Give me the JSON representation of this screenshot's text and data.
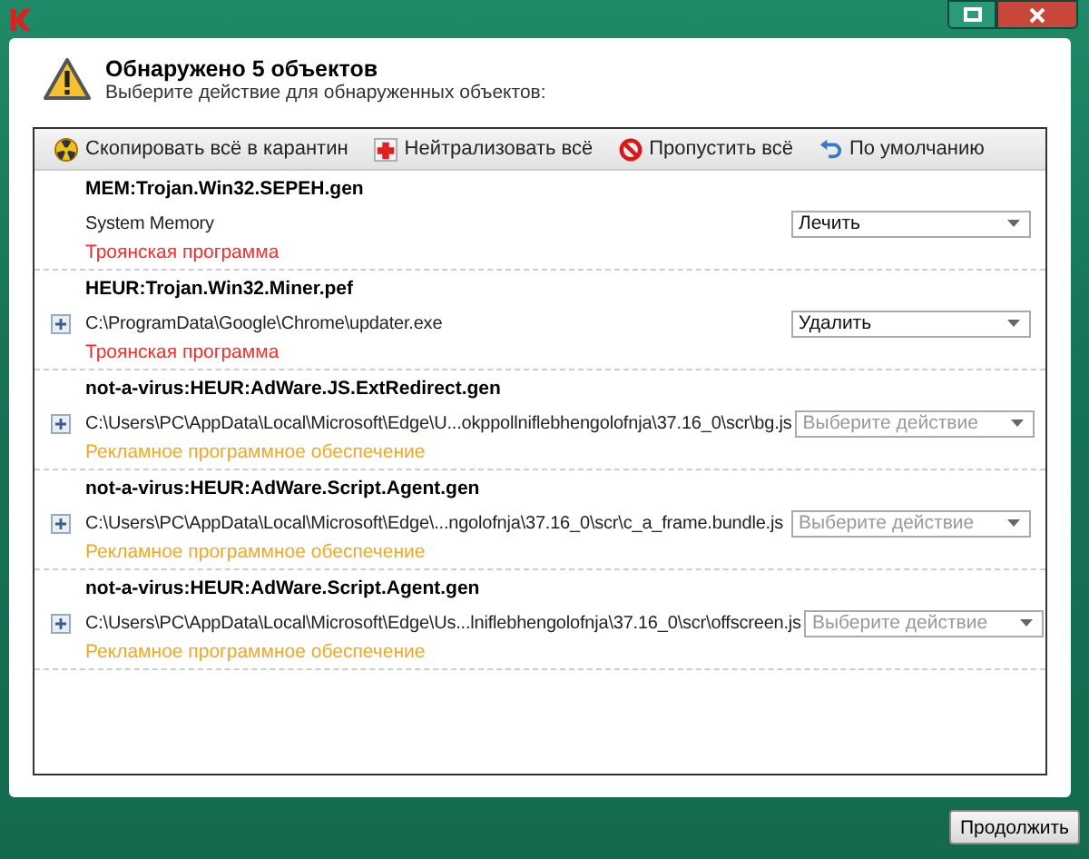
{
  "header": {
    "title": "Обнаружено 5 объектов",
    "subtitle": "Выберите действие для обнаруженных объектов:"
  },
  "toolbar": [
    {
      "label": "Скопировать всё в карантин",
      "kind": "quarantine"
    },
    {
      "label": "Нейтрализовать всё",
      "kind": "cure"
    },
    {
      "label": "Пропустить всё",
      "kind": "skip"
    },
    {
      "label": "По умолчанию",
      "kind": "default"
    }
  ],
  "threats": [
    {
      "name": "MEM:Trojan.Win32.SEPEH.gen",
      "path": "System Memory",
      "category": "Троянская программа",
      "color": "#ff2a2a",
      "expandable": false,
      "action": {
        "value": "Лечить"
      }
    },
    {
      "name": "HEUR:Trojan.Win32.Miner.pef",
      "path": "C:\\ProgramData\\Google\\Chrome\\updater.exe",
      "category": "Троянская программа",
      "color": "#ff2a2a",
      "expandable": true,
      "action": {
        "value": "Удалить"
      }
    },
    {
      "name": "not-a-virus:HEUR:AdWare.JS.ExtRedirect.gen",
      "path": "C:\\Users\\PC\\AppData\\Local\\Microsoft\\Edge\\U...okppollniflebhengolofnja\\37.16_0\\scr\\bg.js",
      "category": "Рекламное программное обеспечение",
      "color": "#f5a623",
      "expandable": true,
      "action": {
        "placeholder": "Выберите действие"
      }
    },
    {
      "name": "not-a-virus:HEUR:AdWare.Script.Agent.gen",
      "path": "C:\\Users\\PC\\AppData\\Local\\Microsoft\\Edge\\...ngolofnja\\37.16_0\\scr\\c_a_frame.bundle.js",
      "category": "Рекламное программное обеспечение",
      "color": "#f5a623",
      "expandable": true,
      "action": {
        "placeholder": "Выберите действие"
      }
    },
    {
      "name": "not-a-virus:HEUR:AdWare.Script.Agent.gen",
      "path": "C:\\Users\\PC\\AppData\\Local\\Microsoft\\Edge\\Us...lniflebhengolofnja\\37.16_0\\scr\\offscreen.js",
      "category": "Рекламное программное обеспечение",
      "color": "#f5a623",
      "expandable": true,
      "action": {
        "placeholder": "Выберите действие"
      }
    }
  ],
  "footer": {
    "continue": "Продолжить"
  }
}
